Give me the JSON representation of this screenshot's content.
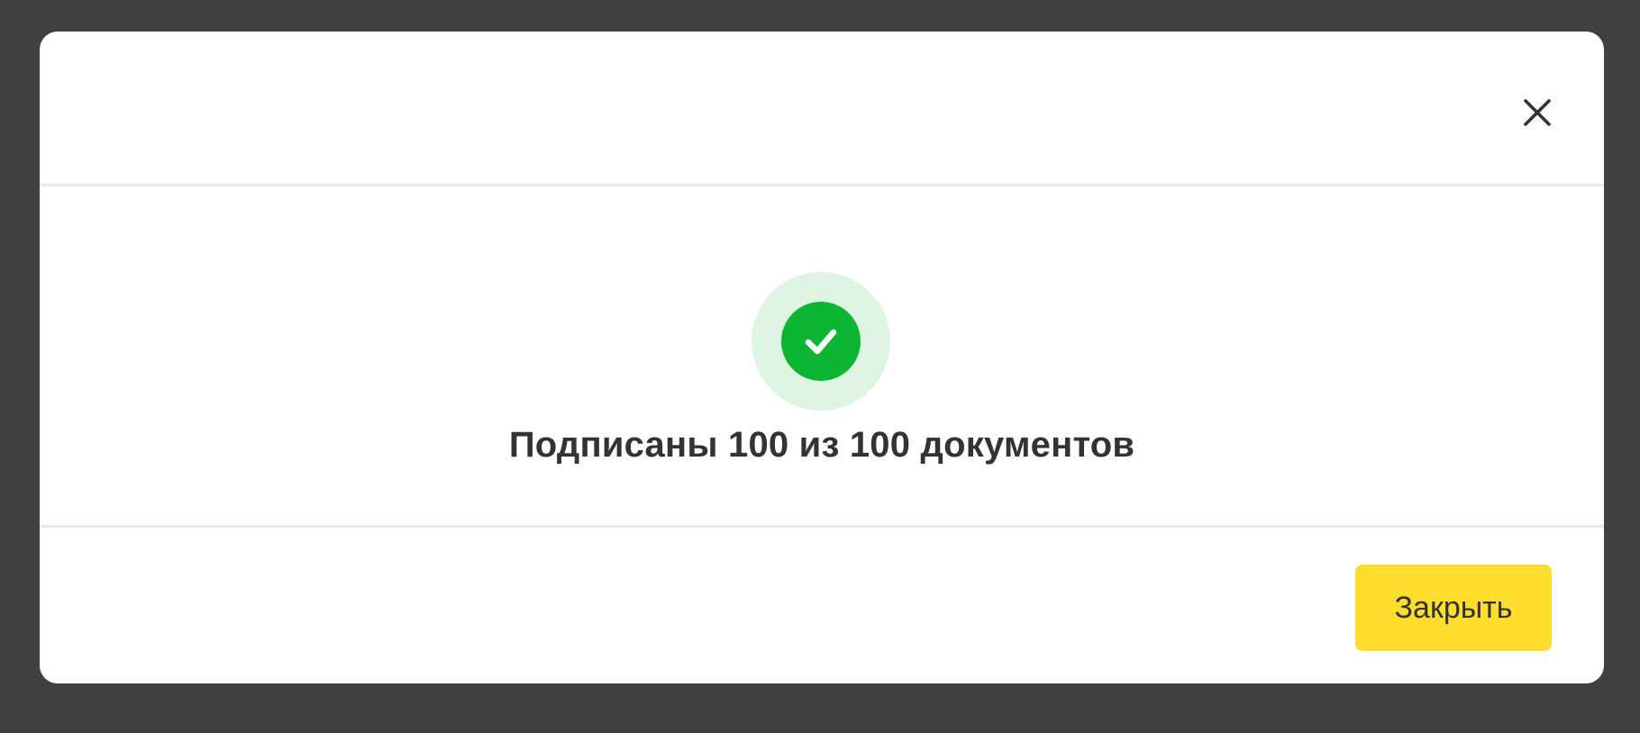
{
  "dialog": {
    "close_icon": "close-icon",
    "status_icon": "check-circle-icon",
    "message": "Подписаны 100 из 100 документов",
    "close_button_label": "Закрыть"
  },
  "colors": {
    "backdrop": "#404040",
    "success_green": "#0db632",
    "success_halo": "#dff5e4",
    "button_yellow": "#ffdd2d",
    "text": "#333333"
  }
}
